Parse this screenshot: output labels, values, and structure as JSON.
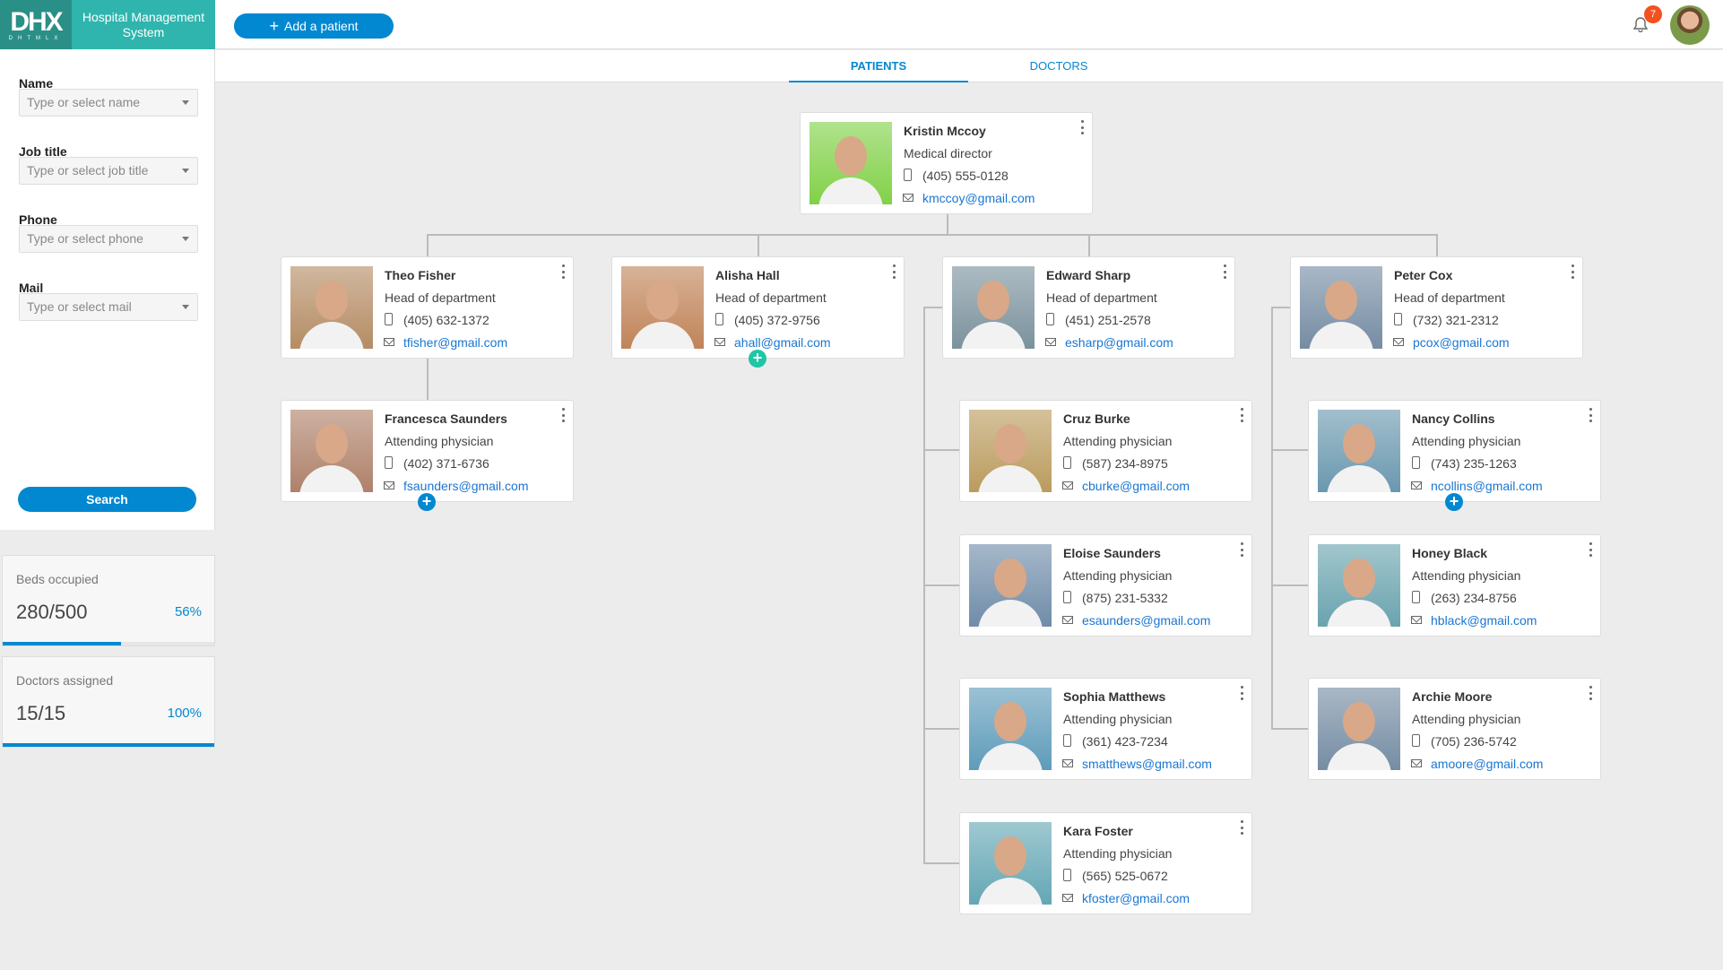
{
  "app": {
    "logo_text": "DHX",
    "logo_sub": "DHTMLX",
    "title": "Hospital Management System"
  },
  "header": {
    "add_label": "Add a patient",
    "add_icon": "plus-icon",
    "notifications": "7"
  },
  "tabs": [
    {
      "label": "Patients",
      "active": true
    },
    {
      "label": "Doctors",
      "active": false
    }
  ],
  "filters": [
    {
      "label": "Name",
      "placeholder": "Type or select name"
    },
    {
      "label": "Job title",
      "placeholder": "Type or select job title"
    },
    {
      "label": "Phone",
      "placeholder": "Type or select phone"
    },
    {
      "label": "Mail",
      "placeholder": "Type or select mail"
    }
  ],
  "search_label": "Search",
  "stats": [
    {
      "label": "Beds occupied",
      "value": "280/500",
      "percent": "56%",
      "progress": 56
    },
    {
      "label": "Doctors assigned",
      "value": "15/15",
      "percent": "100%",
      "progress": 100
    }
  ],
  "colors": {
    "accent": "#0288d1",
    "brand": "#2fb5ad",
    "badge": "#f4511e",
    "add_teal": "#1ec6a5"
  },
  "cards": [
    {
      "name": "Kristin Mccoy",
      "job": "Medical director",
      "phone": "(405) 555-0128",
      "mail": "kmccoy@gmail.com"
    },
    {
      "name": "Theo Fisher",
      "job": "Head of department",
      "phone": "(405) 632-1372",
      "mail": "tfisher@gmail.com"
    },
    {
      "name": "Alisha Hall",
      "job": "Head of department",
      "phone": "(405) 372-9756",
      "mail": "ahall@gmail.com"
    },
    {
      "name": "Edward Sharp",
      "job": "Head of department",
      "phone": "(451) 251-2578",
      "mail": "esharp@gmail.com"
    },
    {
      "name": "Peter Cox",
      "job": "Head of department",
      "phone": "(732) 321-2312",
      "mail": "pcox@gmail.com"
    },
    {
      "name": "Francesca Saunders",
      "job": "Attending physician",
      "phone": "(402) 371-6736",
      "mail": "fsaunders@gmail.com"
    },
    {
      "name": "Cruz Burke",
      "job": "Attending physician",
      "phone": "(587) 234-8975",
      "mail": "cburke@gmail.com"
    },
    {
      "name": "Nancy Collins",
      "job": "Attending physician",
      "phone": "(743) 235-1263",
      "mail": "ncollins@gmail.com"
    },
    {
      "name": "Eloise Saunders",
      "job": "Attending physician",
      "phone": "(875) 231-5332",
      "mail": "esaunders@gmail.com"
    },
    {
      "name": "Honey Black",
      "job": "Attending physician",
      "phone": "(263) 234-8756",
      "mail": "hblack@gmail.com"
    },
    {
      "name": "Sophia Matthews",
      "job": "Attending physician",
      "phone": "(361) 423-7234",
      "mail": "smatthews@gmail.com"
    },
    {
      "name": "Archie Moore",
      "job": "Attending physician",
      "phone": "(705) 236-5742",
      "mail": "amoore@gmail.com"
    },
    {
      "name": "Kara Foster",
      "job": "Attending physician",
      "phone": "(565) 525-0672",
      "mail": "kfoster@gmail.com"
    }
  ]
}
